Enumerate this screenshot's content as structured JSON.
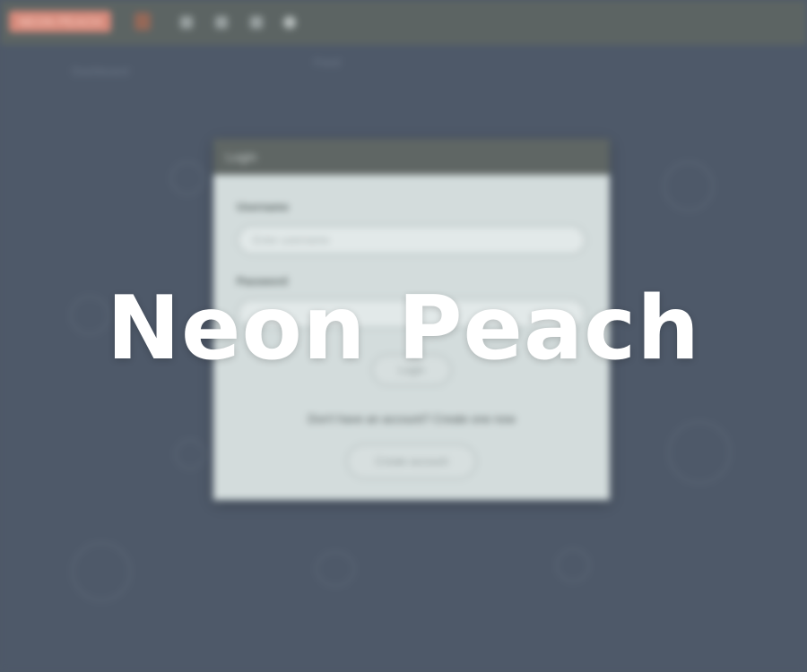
{
  "app": {
    "brand": "NEON PEACH",
    "nav_label_left": "Dashboard",
    "nav_label_mid": "Feed"
  },
  "login_dialog": {
    "title": "Login",
    "username_label": "Username",
    "username_placeholder": "Enter username",
    "password_label": "Password",
    "login_button": "Login",
    "signup_text": "Don't have an account? Create one now",
    "create_button": "Create account"
  },
  "overlay": {
    "title": "Neon Peach"
  },
  "colors": {
    "background": "#4e5969",
    "topbar": "#5c6463",
    "brand_accent": "#d6897a",
    "dialog_bg": "#d3dcdc"
  }
}
